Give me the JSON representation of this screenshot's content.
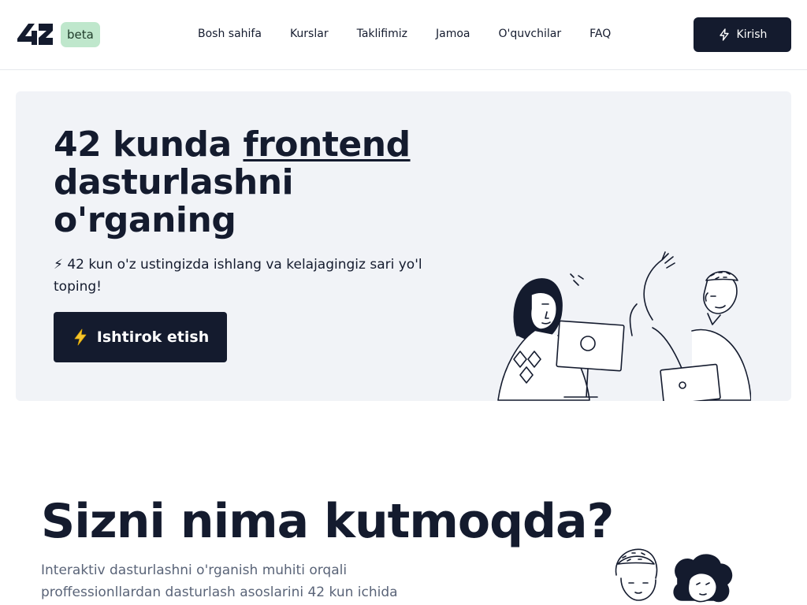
{
  "header": {
    "logo_text": "42",
    "badge": "beta",
    "nav": [
      "Bosh sahifa",
      "Kurslar",
      "Taklifimiz",
      "Jamoa",
      "O'quvchilar",
      "FAQ"
    ],
    "login_label": "Kirish",
    "login_icon": "lightning-icon"
  },
  "hero": {
    "title_part1": "42 kunda ",
    "title_highlight": "frontend",
    "title_part2": "dasturlashni o'rganing",
    "subtitle": "⚡ 42 kun o'z ustingizda ishlang va kelajagingiz sari yo'l toping!",
    "cta_label": "Ishtirok etish",
    "cta_icon": "lightning-emoji-icon"
  },
  "section": {
    "title": "Sizni nima kutmoqda?",
    "description": "Interaktiv dasturlashni o'rganish muhiti orqali proffessionllardan dasturlash asoslarini 42 kun ichida"
  },
  "colors": {
    "primary": "#141b2e",
    "badge_bg": "#bfe7cc",
    "hero_bg": "#f1f3f7",
    "muted_text": "#5a6478"
  }
}
